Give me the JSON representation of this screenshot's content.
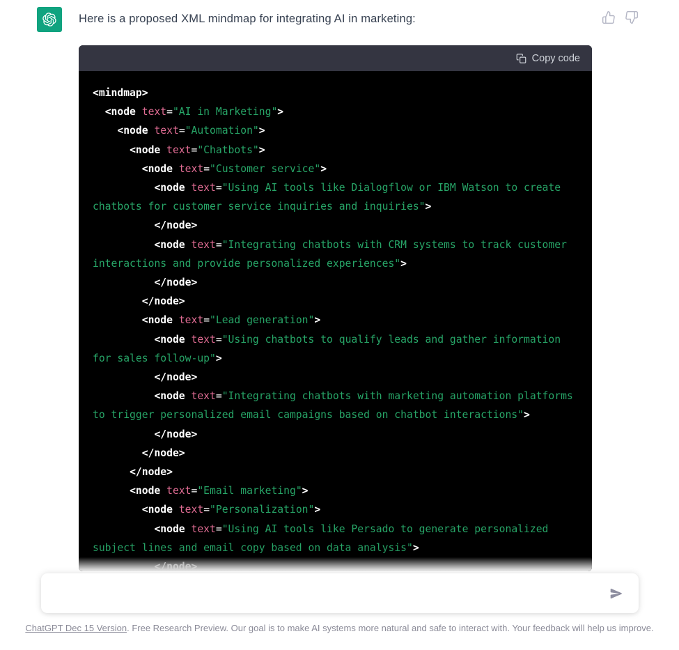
{
  "message": {
    "text": "Here is a proposed XML mindmap for integrating AI in marketing:",
    "avatar_icon": "openai-logo-icon",
    "brand_color": "#10a37f",
    "thumbs_up_icon": "thumbs-up-icon",
    "thumbs_down_icon": "thumbs-down-icon"
  },
  "code_block": {
    "copy_label": "Copy code",
    "copy_icon": "clipboard-icon",
    "language": "xml",
    "header_color": "#343541",
    "background_color": "#000000",
    "colors": {
      "tag": "#ffffff",
      "attribute": "#e06c93",
      "string": "#27a567"
    },
    "lines": [
      {
        "indent": 0,
        "type": "open",
        "tag": "mindmap"
      },
      {
        "indent": 1,
        "type": "node",
        "value": "AI in Marketing"
      },
      {
        "indent": 2,
        "type": "node",
        "value": "Automation"
      },
      {
        "indent": 3,
        "type": "node",
        "value": "Chatbots"
      },
      {
        "indent": 4,
        "type": "node",
        "value": "Customer service"
      },
      {
        "indent": 5,
        "type": "node",
        "value": "Using AI tools like Dialogflow or IBM Watson to create chatbots for customer service inquiries and inquiries"
      },
      {
        "indent": 5,
        "type": "close",
        "tag": "node"
      },
      {
        "indent": 5,
        "type": "node",
        "value": "Integrating chatbots with CRM systems to track customer interactions and provide personalized experiences"
      },
      {
        "indent": 5,
        "type": "close",
        "tag": "node"
      },
      {
        "indent": 4,
        "type": "close",
        "tag": "node"
      },
      {
        "indent": 4,
        "type": "node",
        "value": "Lead generation"
      },
      {
        "indent": 5,
        "type": "node",
        "value": "Using chatbots to qualify leads and gather information for sales follow-up"
      },
      {
        "indent": 5,
        "type": "close",
        "tag": "node"
      },
      {
        "indent": 5,
        "type": "node",
        "value": "Integrating chatbots with marketing automation platforms to trigger personalized email campaigns based on chatbot interactions"
      },
      {
        "indent": 5,
        "type": "close",
        "tag": "node"
      },
      {
        "indent": 4,
        "type": "close",
        "tag": "node"
      },
      {
        "indent": 3,
        "type": "close",
        "tag": "node"
      },
      {
        "indent": 3,
        "type": "node",
        "value": "Email marketing"
      },
      {
        "indent": 4,
        "type": "node",
        "value": "Personalization"
      },
      {
        "indent": 5,
        "type": "node",
        "value": "Using AI tools like Persado to generate personalized subject lines and email copy based on data analysis"
      },
      {
        "indent": 5,
        "type": "close",
        "tag": "node"
      }
    ]
  },
  "composer": {
    "value": "",
    "placeholder": "",
    "send_icon": "send-arrow-icon"
  },
  "footer": {
    "link_text": "ChatGPT Dec 15 Version",
    "rest_text": ". Free Research Preview. Our goal is to make AI systems more natural and safe to interact with. Your feedback will help us improve."
  }
}
